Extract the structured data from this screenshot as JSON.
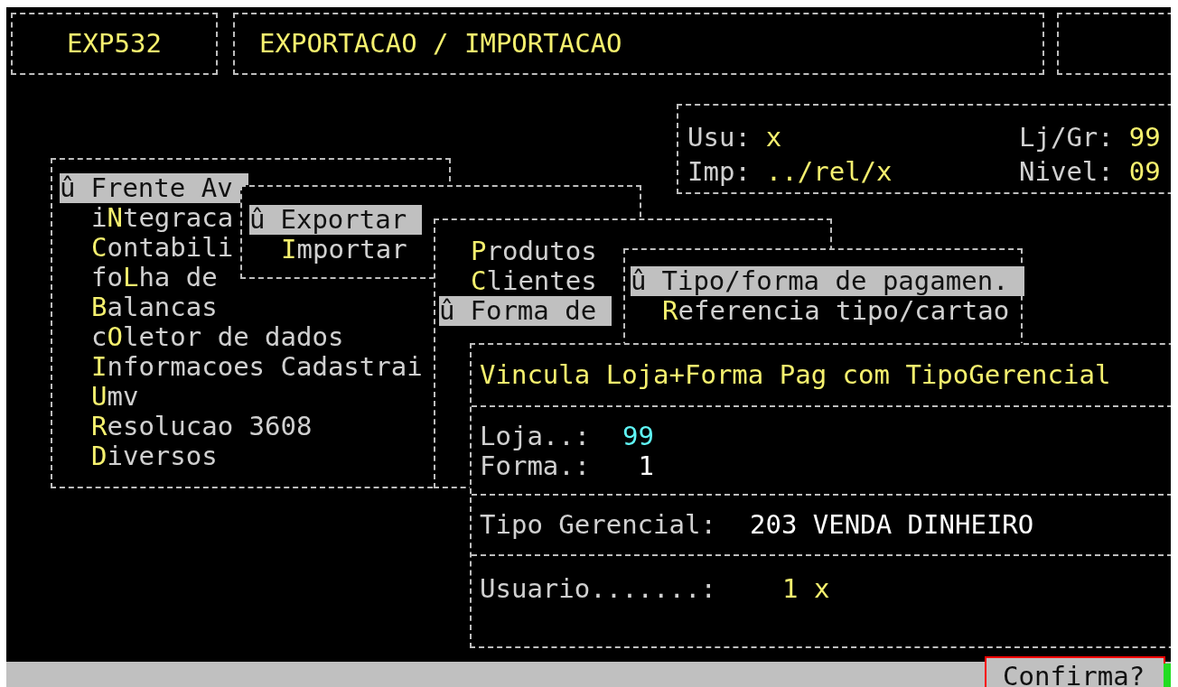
{
  "header": {
    "code": "EXP532",
    "title": "EXPORTACAO / IMPORTACAO"
  },
  "session": {
    "fields": [
      {
        "label": "Usu:",
        "value": "x"
      },
      {
        "label": "Lj/Gr:",
        "value": "99"
      },
      {
        "label": "Imp:",
        "value": "../rel/x"
      },
      {
        "label": "Nivel:",
        "value": "09"
      }
    ]
  },
  "menus": [
    {
      "items": [
        {
          "marker": "û",
          "selected": true,
          "segments": [
            {
              "text": "Frente Av",
              "hotkey": false
            }
          ]
        },
        {
          "selected": false,
          "segments": [
            {
              "text": "i",
              "hotkey": false
            },
            {
              "text": "N",
              "hotkey": true
            },
            {
              "text": "tegraca",
              "hotkey": false
            }
          ]
        },
        {
          "selected": false,
          "segments": [
            {
              "text": "C",
              "hotkey": true
            },
            {
              "text": "ontabili",
              "hotkey": false
            }
          ]
        },
        {
          "selected": false,
          "segments": [
            {
              "text": "fo",
              "hotkey": false
            },
            {
              "text": "L",
              "hotkey": true
            },
            {
              "text": "ha de",
              "hotkey": false
            }
          ]
        },
        {
          "selected": false,
          "segments": [
            {
              "text": "B",
              "hotkey": true
            },
            {
              "text": "alancas",
              "hotkey": false
            }
          ]
        },
        {
          "selected": false,
          "segments": [
            {
              "text": "c",
              "hotkey": false
            },
            {
              "text": "O",
              "hotkey": true
            },
            {
              "text": "letor de dados",
              "hotkey": false
            }
          ]
        },
        {
          "selected": false,
          "segments": [
            {
              "text": "I",
              "hotkey": true
            },
            {
              "text": "nformacoes Cadastrai",
              "hotkey": false
            }
          ]
        },
        {
          "selected": false,
          "segments": [
            {
              "text": "U",
              "hotkey": true
            },
            {
              "text": "mv",
              "hotkey": false
            }
          ]
        },
        {
          "selected": false,
          "segments": [
            {
              "text": "R",
              "hotkey": true
            },
            {
              "text": "esolucao 3608",
              "hotkey": false
            }
          ]
        },
        {
          "selected": false,
          "segments": [
            {
              "text": "D",
              "hotkey": true
            },
            {
              "text": "iversos",
              "hotkey": false
            }
          ]
        }
      ]
    },
    {
      "items": [
        {
          "marker": "û",
          "selected": true,
          "segments": [
            {
              "text": "Exportar",
              "hotkey": false
            }
          ]
        },
        {
          "selected": false,
          "segments": [
            {
              "text": "I",
              "hotkey": true
            },
            {
              "text": "mportar",
              "hotkey": false
            }
          ]
        }
      ]
    },
    {
      "items": [
        {
          "selected": false,
          "segments": [
            {
              "text": "P",
              "hotkey": true
            },
            {
              "text": "rodutos",
              "hotkey": false
            }
          ]
        },
        {
          "selected": false,
          "segments": [
            {
              "text": "C",
              "hotkey": true
            },
            {
              "text": "lientes",
              "hotkey": false
            }
          ]
        },
        {
          "marker": "û",
          "selected": true,
          "segments": [
            {
              "text": "Forma de",
              "hotkey": false
            }
          ]
        }
      ]
    },
    {
      "items": [
        {
          "marker": "û",
          "selected": true,
          "segments": [
            {
              "text": "Tipo/forma de pagamen.",
              "hotkey": false
            }
          ]
        },
        {
          "selected": false,
          "segments": [
            {
              "text": "R",
              "hotkey": true
            },
            {
              "text": "eferencia tipo/cartao",
              "hotkey": false
            }
          ]
        }
      ]
    }
  ],
  "dialog": {
    "title": "Vincula Loja+Forma Pag com TipoGerencial",
    "sections": [
      {
        "fields": [
          {
            "label": "Loja..:",
            "value": "99",
            "color": "#5ff5f5"
          },
          {
            "label": "Forma.:",
            "value": "1",
            "color": "#ffffff"
          }
        ]
      },
      {
        "fields": [
          {
            "label": "Tipo Gerencial:",
            "value": "203 VENDA DINHEIRO",
            "color": "#ffffff"
          }
        ]
      },
      {
        "fields": [
          {
            "label": "Usuario.......:",
            "value": "1 x",
            "color": "#f5f06e"
          }
        ]
      }
    ]
  },
  "status_bar": {
    "prompt": "Confirma?"
  }
}
